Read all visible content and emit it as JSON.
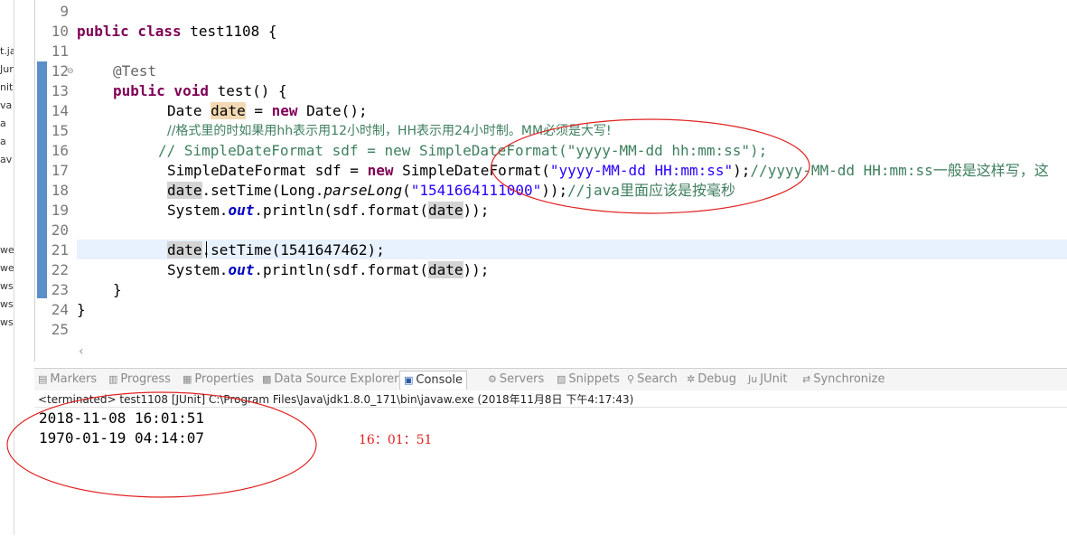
{
  "left_strip": [
    "t.ja",
    "Jur",
    "nit.",
    "va",
    "a",
    "a",
    "av",
    "we",
    "we",
    "ws",
    "ws",
    "ws"
  ],
  "editor": {
    "line_numbers": [
      "9",
      "10",
      "11",
      "12",
      "13",
      "14",
      "15",
      "16",
      "17",
      "18",
      "19",
      "20",
      "21",
      "22",
      "23",
      "24",
      "25"
    ],
    "code": {
      "l10_kw": "public class",
      "l10_rest": " test1108 {",
      "l12_ann": "@Test",
      "l13_kw": "public void",
      "l13_rest": " test() {",
      "l14_a": "Date ",
      "l14_var": "date",
      "l14_b": " = ",
      "l14_kw": "new",
      "l14_c": " Date();",
      "l15_cmt": "//格式里的时如果用hh表示用12小时制，HH表示用24小时制。MM必须是大写!",
      "l16_cmt": "// SimpleDateFormat sdf = new SimpleDateFormat(\"yyyy-MM-dd hh:mm:ss\");",
      "l17_a": "SimpleDateFormat sdf = ",
      "l17_kw": "new",
      "l17_b": " SimpleDateFormat(",
      "l17_str": "\"yyyy-MM-dd HH:mm:ss\"",
      "l17_c": ");",
      "l17_cmt": "//yyyy-MM-dd HH:mm:ss一般是这样写，这",
      "l18_var": "date",
      "l18_a": ".setTime(Long.",
      "l18_ital": "parseLong",
      "l18_b": "(",
      "l18_str": "\"1541664111000\"",
      "l18_c": "));",
      "l18_cmt": "//java里面应该是按毫秒",
      "l19_a": "System.",
      "l19_static": "out",
      "l19_b": ".println(sdf.format(",
      "l19_var": "date",
      "l19_c": "));",
      "l21_var": "date",
      "l21_a": ".setTime(1541647462);",
      "l22_a": "System.",
      "l22_static": "out",
      "l22_b": ".println(sdf.format(",
      "l22_var": "date",
      "l22_c": "));",
      "l23": "}",
      "l24": "}"
    }
  },
  "tabs": [
    {
      "label": "Markers",
      "icon": "markers-icon"
    },
    {
      "label": "Progress",
      "icon": "progress-icon"
    },
    {
      "label": "Properties",
      "icon": "properties-icon"
    },
    {
      "label": "Data Source Explorer",
      "icon": "data-source-icon"
    },
    {
      "label": "Console",
      "icon": "console-icon",
      "active": true
    },
    {
      "label": "Servers",
      "icon": "servers-icon"
    },
    {
      "label": "Snippets",
      "icon": "snippets-icon"
    },
    {
      "label": "Search",
      "icon": "search-icon"
    },
    {
      "label": "Debug",
      "icon": "debug-icon"
    },
    {
      "label": "JUnit",
      "icon": "junit-icon"
    },
    {
      "label": "Synchronize",
      "icon": "synchronize-icon"
    }
  ],
  "console": {
    "terminated": "<terminated> test1108 [JUnit] C:\\Program Files\\Java\\jdk1.8.0_171\\bin\\javaw.exe (2018年11月8日 下午4:17:43)",
    "output": [
      "2018-11-08 16:01:51",
      "1970-01-19 04:14:07"
    ]
  },
  "annotation": {
    "note": "16：01：51",
    "color": "#e02020"
  }
}
